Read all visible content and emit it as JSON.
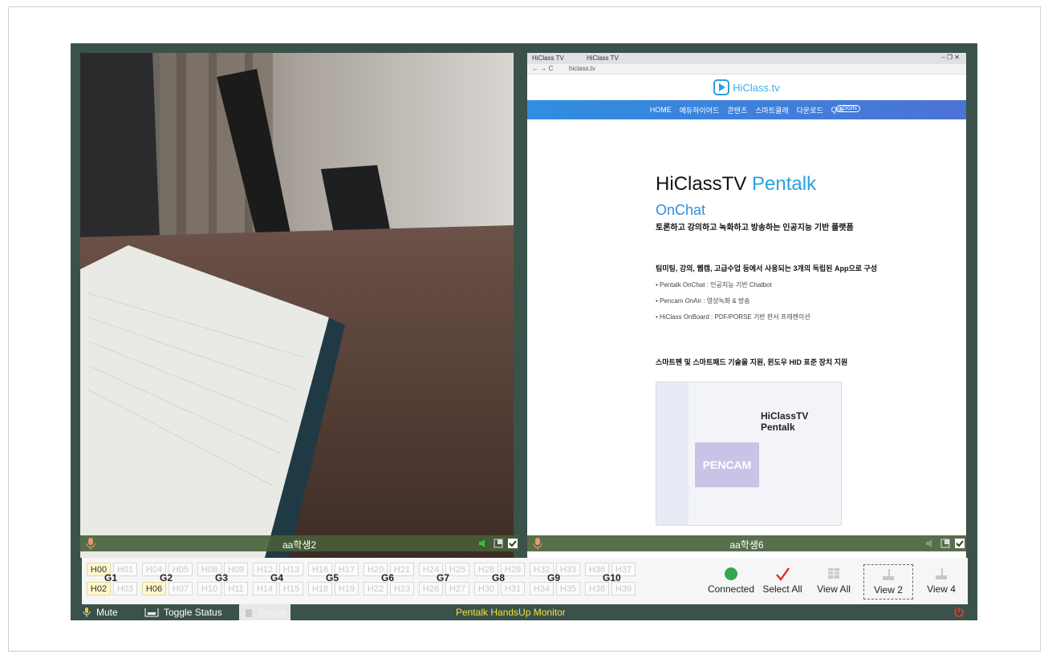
{
  "videos": {
    "left": {
      "name": "aa학생2"
    },
    "right": {
      "name": "aa학생6"
    }
  },
  "browser": {
    "tabs": [
      "HiClass TV",
      "HiClass TV"
    ],
    "address": "hiclass.tv",
    "logo_text": "HiClass.tv",
    "nav": [
      "HOME",
      "에듀하이어드",
      "콘텐츠",
      "스마트클래",
      "다운로드",
      "Q/A"
    ],
    "nav_button": "LOGIN",
    "heading_dark": "HiClassTV",
    "heading_blue": "Pentalk",
    "onchat": "OnChat",
    "subtitle": "토론하고 강의하고 녹화하고 방송하는 인공지능 기반 플랫폼",
    "section1": "팀미팅, 강의, 웹캠, 고급수업 등에서 사용되는 3개의 독립된 App으로 구성",
    "bullets": [
      "• Pentalk OnChat : 인공지능 기반 Chatbot",
      "• Pencam OnAir : 영상녹화 & 방송",
      "• HiClass OnBoard : PDF/PORSE 기반 판서 프레젠이션"
    ],
    "section2": "스마트펜 및 스마트패드 기술을 지원, 윈도우 HID 표준 장치 지원",
    "promo_title": "HiClassTV Pentalk",
    "promo_pencam": "PENCAM"
  },
  "groups": [
    {
      "label": "G1",
      "top": [
        "H00",
        "H01"
      ],
      "bottom": [
        "H02",
        "H03"
      ],
      "on": [
        "H00",
        "H02"
      ]
    },
    {
      "label": "G2",
      "top": [
        "H04",
        "H05"
      ],
      "bottom": [
        "H06",
        "H07"
      ],
      "on": [
        "H06"
      ]
    },
    {
      "label": "G3",
      "top": [
        "H08",
        "H09"
      ],
      "bottom": [
        "H10",
        "H11"
      ],
      "on": []
    },
    {
      "label": "G4",
      "top": [
        "H12",
        "H13"
      ],
      "bottom": [
        "H14",
        "H15"
      ],
      "on": []
    },
    {
      "label": "G5",
      "top": [
        "H16",
        "H17"
      ],
      "bottom": [
        "H18",
        "H19"
      ],
      "on": []
    },
    {
      "label": "G6",
      "top": [
        "H20",
        "H21"
      ],
      "bottom": [
        "H22",
        "H23"
      ],
      "on": []
    },
    {
      "label": "G7",
      "top": [
        "H24",
        "H25"
      ],
      "bottom": [
        "H26",
        "H27"
      ],
      "on": []
    },
    {
      "label": "G8",
      "top": [
        "H28",
        "H29"
      ],
      "bottom": [
        "H30",
        "H31"
      ],
      "on": []
    },
    {
      "label": "G9",
      "top": [
        "H32",
        "H33"
      ],
      "bottom": [
        "H34",
        "H35"
      ],
      "on": []
    },
    {
      "label": "G10",
      "top": [
        "H36",
        "H37"
      ],
      "bottom": [
        "H38",
        "H39"
      ],
      "on": []
    }
  ],
  "toolbar": {
    "connected": "Connected",
    "select_all": "Select All",
    "view_all": "View All",
    "view2": "View 2",
    "view4": "View 4",
    "connected_color": "#2fa84f",
    "check_color": "#e0352b"
  },
  "statusbar": {
    "mute": "Mute",
    "toggle": "Toggle Status",
    "pause": "Pause",
    "title": "Pentalk HandsUp Monitor",
    "title_color": "#f2e03a",
    "power_color": "#e53b2c"
  }
}
